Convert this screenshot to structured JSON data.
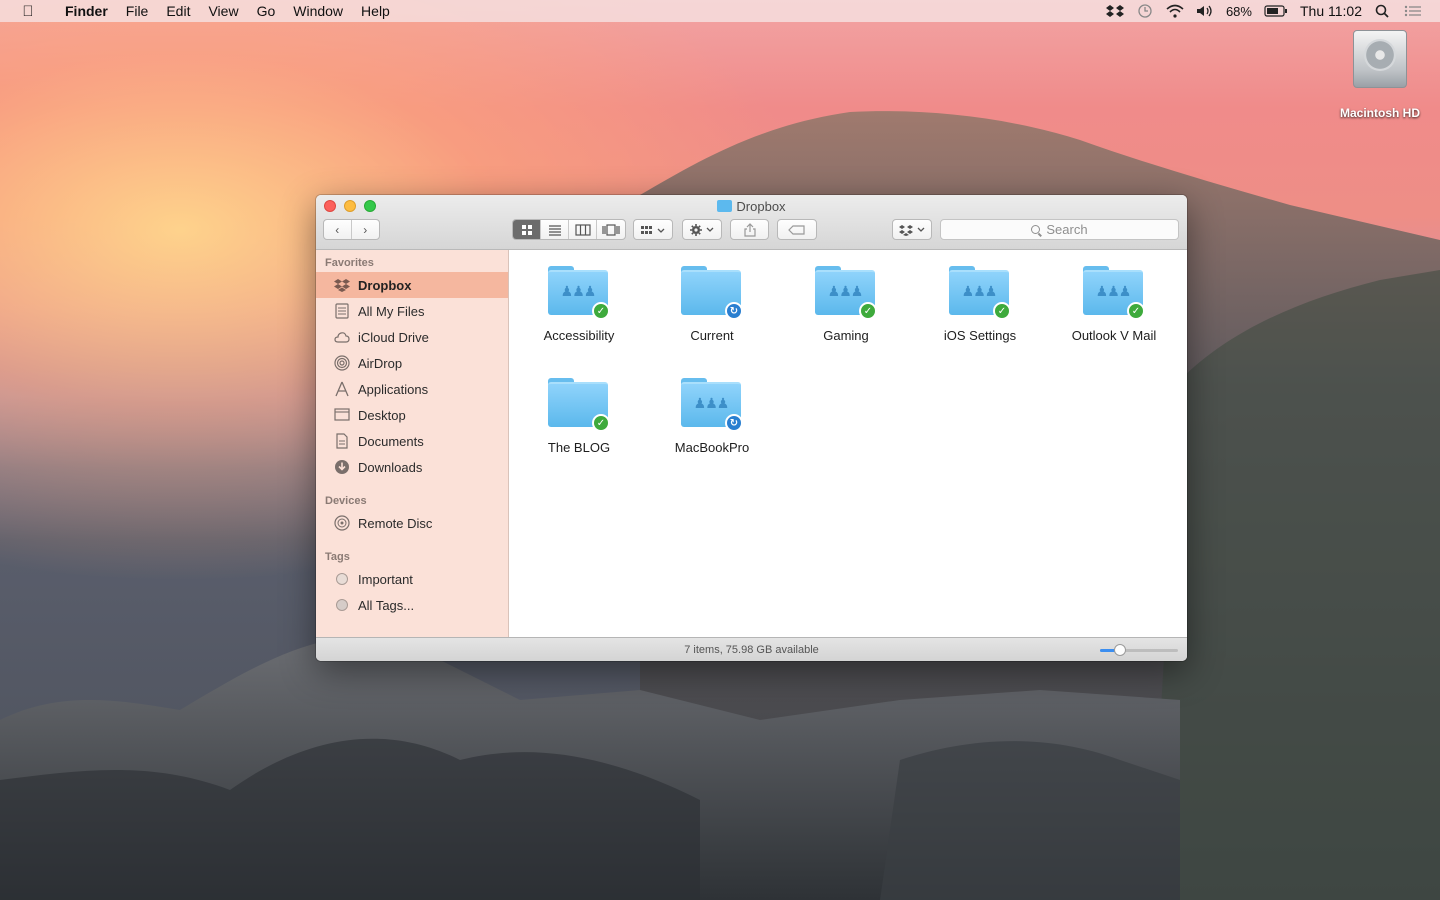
{
  "menubar": {
    "app_name": "Finder",
    "menus": [
      "File",
      "Edit",
      "View",
      "Go",
      "Window",
      "Help"
    ],
    "battery_percent": "68%",
    "clock": "Thu 11:02"
  },
  "desktop": {
    "hd_label": "Macintosh HD"
  },
  "window": {
    "title": "Dropbox",
    "search_placeholder": "Search",
    "status_text": "7 items, 75.98 GB available",
    "icon_size_level": 0.25
  },
  "sidebar": {
    "favorites_header": "Favorites",
    "favorites": [
      {
        "label": "Dropbox",
        "icon": "dropbox-icon"
      },
      {
        "label": "All My Files",
        "icon": "all-my-files-icon"
      },
      {
        "label": "iCloud Drive",
        "icon": "cloud-icon"
      },
      {
        "label": "AirDrop",
        "icon": "airdrop-icon"
      },
      {
        "label": "Applications",
        "icon": "applications-icon"
      },
      {
        "label": "Desktop",
        "icon": "desktop-icon"
      },
      {
        "label": "Documents",
        "icon": "documents-icon"
      },
      {
        "label": "Downloads",
        "icon": "downloads-icon"
      }
    ],
    "devices_header": "Devices",
    "devices": [
      {
        "label": "Remote Disc",
        "icon": "disc-icon"
      }
    ],
    "tags_header": "Tags",
    "tags": [
      {
        "label": "Important"
      },
      {
        "label": "All Tags..."
      }
    ]
  },
  "files": [
    {
      "name": "Accessibility",
      "shared": true,
      "status": "synced"
    },
    {
      "name": "Current",
      "shared": false,
      "status": "syncing"
    },
    {
      "name": "Gaming",
      "shared": true,
      "status": "synced"
    },
    {
      "name": "iOS Settings",
      "shared": true,
      "status": "synced"
    },
    {
      "name": "Outlook V Mail",
      "shared": true,
      "status": "synced"
    },
    {
      "name": "The BLOG",
      "shared": false,
      "status": "synced"
    },
    {
      "name": "MacBookPro",
      "shared": true,
      "status": "syncing"
    }
  ],
  "colors": {
    "selected_sidebar": "#f5b79f",
    "folder_blue": "#5bb8ec",
    "synced_green": "#3eaa3c",
    "syncing_blue": "#2a7fd0"
  }
}
